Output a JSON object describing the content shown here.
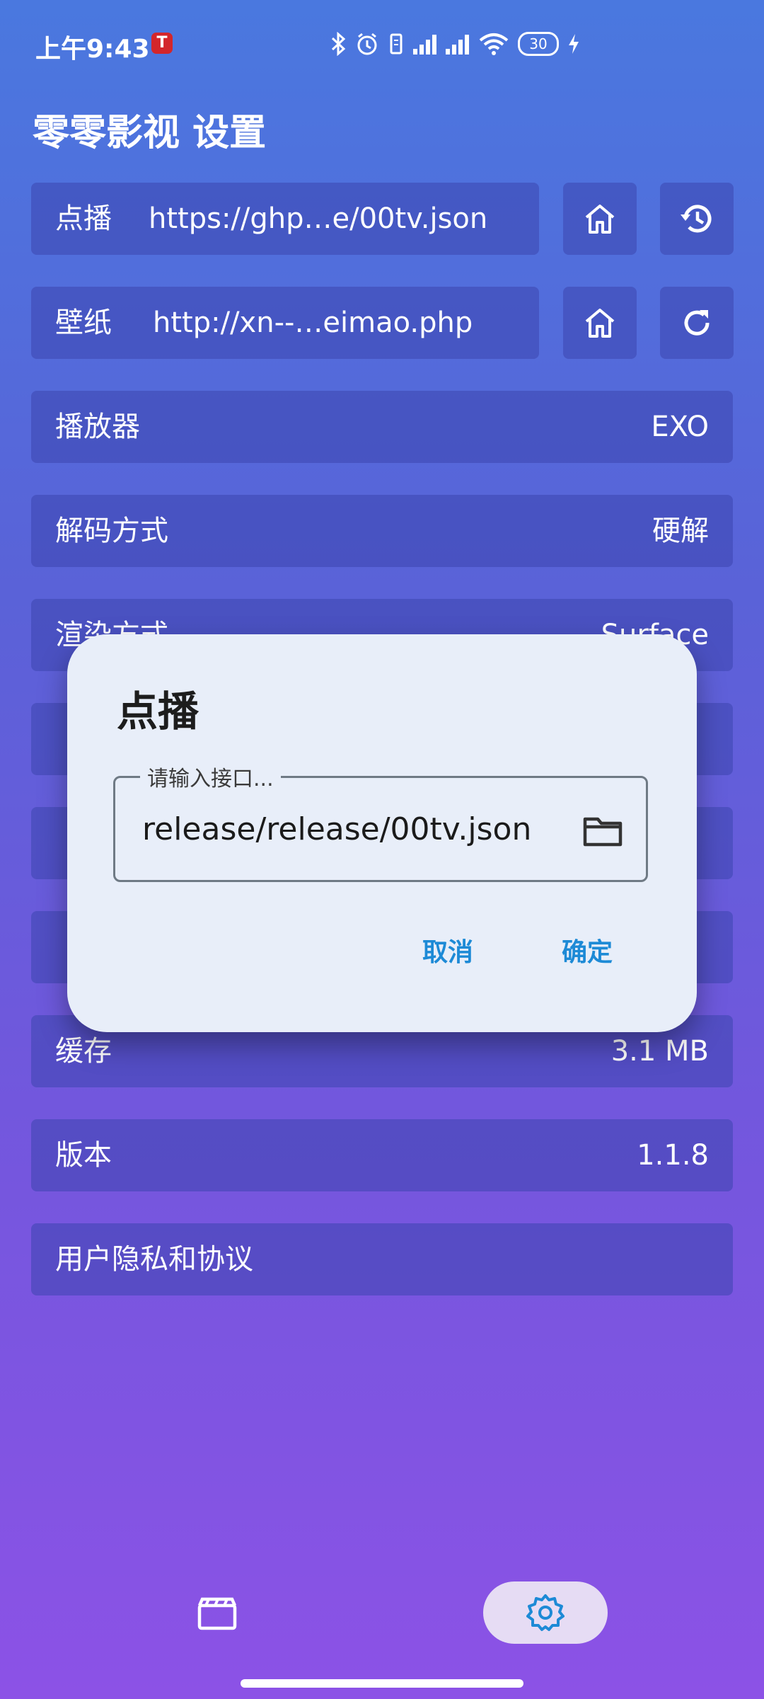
{
  "status_bar": {
    "time": "上午9:43",
    "tesla_badge": "T",
    "battery_level": "30"
  },
  "page": {
    "title": "零零影视 设置"
  },
  "settings": {
    "vod_label": "点播",
    "vod_url": "https://ghp…e/00tv.json",
    "wallpaper_label": "壁纸",
    "wallpaper_url": "http://xn--…eimao.php",
    "rows": [
      {
        "label": "播放器",
        "value": "EXO"
      },
      {
        "label": "解码方式",
        "value": "硬解"
      },
      {
        "label": "渲染方式",
        "value": "Surface"
      },
      {
        "label": "",
        "value": ""
      },
      {
        "label": "",
        "value": ""
      },
      {
        "label": "",
        "value": ""
      },
      {
        "label": "缓存",
        "value": "3.1 MB"
      },
      {
        "label": "版本",
        "value": "1.1.8"
      },
      {
        "label": "用户隐私和协议",
        "value": ""
      }
    ]
  },
  "dialog": {
    "title": "点播",
    "field_label": "请输入接口...",
    "field_value": "release/release/00tv.json",
    "cancel_label": "取消",
    "confirm_label": "确定"
  },
  "nav": {
    "items": [
      "film-icon",
      "settings-icon"
    ],
    "active": "settings-icon"
  },
  "colors": {
    "accent": "#1d8ad6",
    "dialog_bg": "#e8eef9",
    "nav_active_bg": "#e6dcf4"
  }
}
